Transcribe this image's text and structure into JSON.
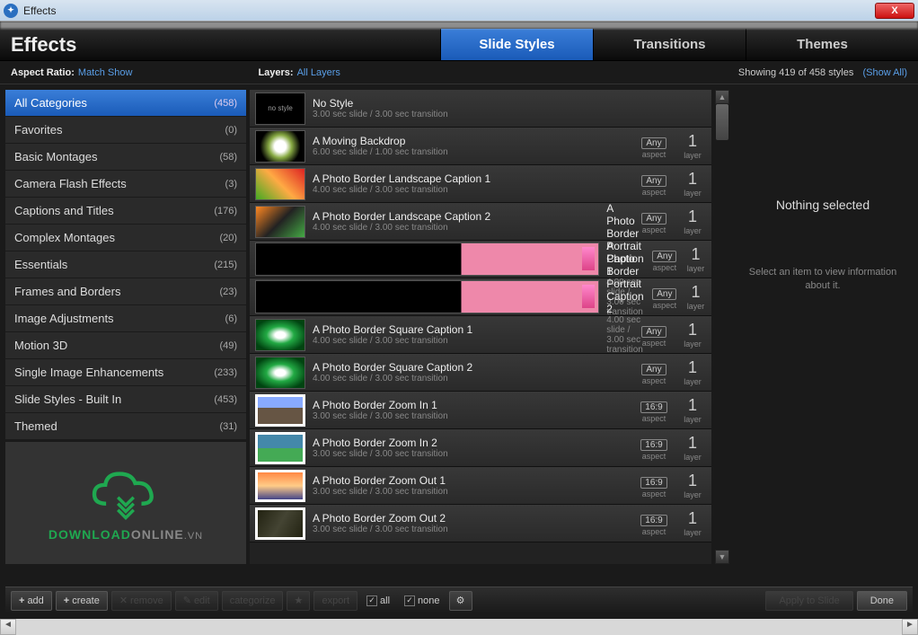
{
  "window": {
    "title": "Effects",
    "close": "X"
  },
  "header": {
    "title": "Effects",
    "tabs": [
      {
        "label": "Slide Styles",
        "active": true
      },
      {
        "label": "Transitions",
        "active": false
      },
      {
        "label": "Themes",
        "active": false
      }
    ]
  },
  "filter": {
    "aspect_label": "Aspect Ratio:",
    "aspect_value": "Match Show",
    "layers_label": "Layers:",
    "layers_value": "All Layers",
    "count_text": "Showing 419 of 458 styles",
    "show_all": "(Show All)"
  },
  "categories": [
    {
      "name": "All Categories",
      "count": "(458)",
      "selected": true
    },
    {
      "name": "Favorites",
      "count": "(0)"
    },
    {
      "name": "Basic Montages",
      "count": "(58)"
    },
    {
      "name": "Camera Flash Effects",
      "count": "(3)"
    },
    {
      "name": "Captions and Titles",
      "count": "(176)"
    },
    {
      "name": "Complex Montages",
      "count": "(20)"
    },
    {
      "name": "Essentials",
      "count": "(215)"
    },
    {
      "name": "Frames and Borders",
      "count": "(23)"
    },
    {
      "name": "Image Adjustments",
      "count": "(6)"
    },
    {
      "name": "Motion 3D",
      "count": "(49)"
    },
    {
      "name": "Single Image Enhancements",
      "count": "(233)"
    },
    {
      "name": "Slide Styles - Built In",
      "count": "(453)"
    },
    {
      "name": "Themed",
      "count": "(31)"
    }
  ],
  "styles": [
    {
      "name": "No Style",
      "desc": "3.00 sec slide / 3.00 sec transition",
      "aspect": "",
      "layers": "",
      "thumb": "no style",
      "th_class": ""
    },
    {
      "name": "A Moving Backdrop",
      "desc": "6.00 sec slide / 1.00 sec transition",
      "aspect": "Any",
      "layers": "1",
      "th_class": "th-flower"
    },
    {
      "name": "A Photo Border Landscape Caption 1",
      "desc": "4.00 sec slide / 3.00 sec transition",
      "aspect": "Any",
      "layers": "1",
      "th_class": "th-bfly1"
    },
    {
      "name": "A Photo Border Landscape Caption 2",
      "desc": "4.00 sec slide / 3.00 sec transition",
      "aspect": "Any",
      "layers": "1",
      "th_class": "th-bfly2"
    },
    {
      "name": "A Photo Border Portrait Caption 1",
      "desc": "4.00 sec slide / 3.00 sec transition",
      "aspect": "Any",
      "layers": "1",
      "th_class": "th-pink"
    },
    {
      "name": "A Photo Border Portrait Caption 2",
      "desc": "4.00 sec slide / 3.00 sec transition",
      "aspect": "Any",
      "layers": "1",
      "th_class": "th-pink"
    },
    {
      "name": "A Photo Border Square Caption 1",
      "desc": "4.00 sec slide / 3.00 sec transition",
      "aspect": "Any",
      "layers": "1",
      "th_class": "th-leaf"
    },
    {
      "name": "A Photo Border Square Caption 2",
      "desc": "4.00 sec slide / 3.00 sec transition",
      "aspect": "Any",
      "layers": "1",
      "th_class": "th-leaf"
    },
    {
      "name": "A Photo Border Zoom In 1",
      "desc": "3.00 sec slide / 3.00 sec transition",
      "aspect": "16:9",
      "layers": "1",
      "th_class": "th-city"
    },
    {
      "name": "A Photo Border Zoom In 2",
      "desc": "3.00 sec slide / 3.00 sec transition",
      "aspect": "16:9",
      "layers": "1",
      "th_class": "th-mtn"
    },
    {
      "name": "A Photo Border Zoom Out 1",
      "desc": "3.00 sec slide / 3.00 sec transition",
      "aspect": "16:9",
      "layers": "1",
      "th_class": "th-sunset"
    },
    {
      "name": "A Photo Border Zoom Out 2",
      "desc": "3.00 sec slide / 3.00 sec transition",
      "aspect": "16:9",
      "layers": "1",
      "th_class": "th-dark"
    }
  ],
  "aspect_label": "aspect",
  "layer_label": "layer",
  "preview": {
    "title": "Nothing selected",
    "msg": "Select an item to view information about it."
  },
  "bottom": {
    "add": "add",
    "create": "create",
    "remove": "remove",
    "edit": "edit",
    "categorize": "categorize",
    "export": "export",
    "all": "all",
    "none": "none",
    "apply": "Apply to Slide",
    "done": "Done"
  },
  "logo": {
    "part1": "DOWNLOAD",
    "part2": "ONLINE",
    "part3": ".VN"
  }
}
